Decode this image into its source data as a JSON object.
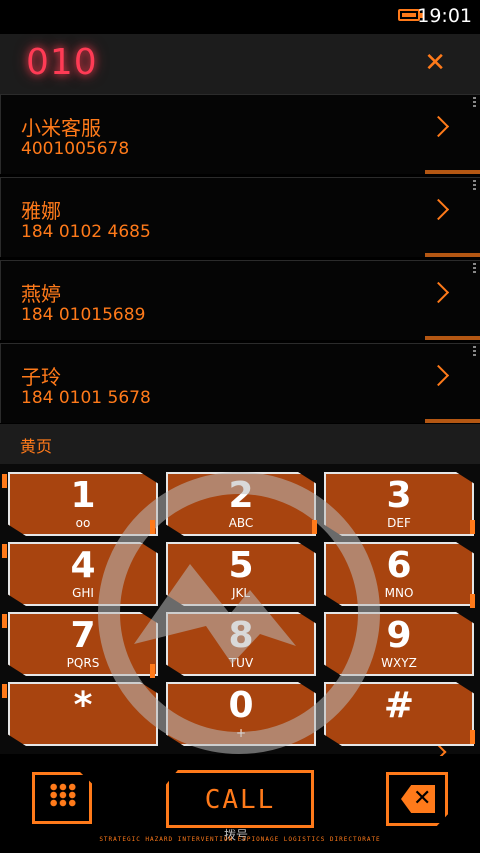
{
  "status_bar": {
    "time": "19:01",
    "battery_icon": "battery-icon"
  },
  "dialer": {
    "dialed_number": "010",
    "clear_icon": "close-icon"
  },
  "contacts": [
    {
      "name": "小米客服",
      "number": "4001005678"
    },
    {
      "name": "雅娜",
      "number": "184 0102 4685"
    },
    {
      "name": "燕婷",
      "number": "184 01015689"
    },
    {
      "name": "子玲",
      "number": "184 0101 5678"
    }
  ],
  "section": {
    "label": "黄页"
  },
  "keypad": {
    "keys": [
      {
        "digit": "1",
        "letters": ""
      },
      {
        "digit": "2",
        "letters": "ABC"
      },
      {
        "digit": "3",
        "letters": "DEF"
      },
      {
        "digit": "4",
        "letters": "GHI"
      },
      {
        "digit": "5",
        "letters": "JKL"
      },
      {
        "digit": "6",
        "letters": "MNO"
      },
      {
        "digit": "7",
        "letters": "PQRS"
      },
      {
        "digit": "8",
        "letters": "TUV"
      },
      {
        "digit": "9",
        "letters": "WXYZ"
      },
      {
        "digit": "*",
        "letters": ""
      },
      {
        "digit": "0",
        "letters": "+"
      },
      {
        "digit": "#",
        "letters": ""
      }
    ]
  },
  "bottom_bar": {
    "call_label": "CALL",
    "call_sub": "拨号",
    "footer": "STRATEGIC HAZARD INTERVENTION ESPIONAGE LOGISTICS DIRECTORATE"
  },
  "colors": {
    "accent": "#ff7a1a",
    "key_fill": "#a8440f",
    "dialed_text": "#ff3b55"
  }
}
